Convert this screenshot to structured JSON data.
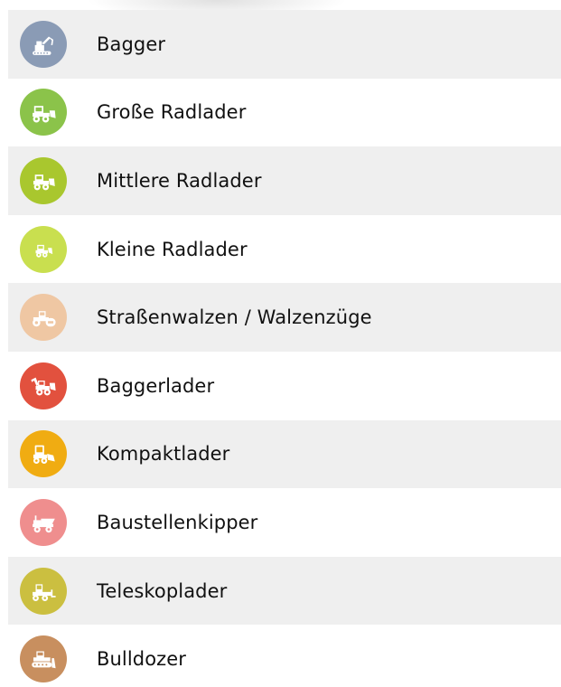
{
  "categories": [
    {
      "label": "Bagger",
      "icon": "excavator-icon",
      "color": "#8a9bb5"
    },
    {
      "label": "Große Radlader",
      "icon": "large-wheel-loader-icon",
      "color": "#8bc34a"
    },
    {
      "label": "Mittlere Radlader",
      "icon": "medium-wheel-loader-icon",
      "color": "#a9c72e"
    },
    {
      "label": "Kleine Radlader",
      "icon": "small-wheel-loader-icon",
      "color": "#c9df4f"
    },
    {
      "label": "Straßenwalzen / Walzenzüge",
      "icon": "road-roller-icon",
      "color": "#efc7a3"
    },
    {
      "label": "Baggerlader",
      "icon": "backhoe-loader-icon",
      "color": "#e2513e"
    },
    {
      "label": "Kompaktlader",
      "icon": "skid-steer-loader-icon",
      "color": "#f0ac12"
    },
    {
      "label": "Baustellenkipper",
      "icon": "site-dumper-icon",
      "color": "#ef8e8e"
    },
    {
      "label": "Teleskoplader",
      "icon": "telehandler-icon",
      "color": "#cbbf40"
    },
    {
      "label": "Bulldozer",
      "icon": "bulldozer-icon",
      "color": "#c88f5f"
    }
  ]
}
